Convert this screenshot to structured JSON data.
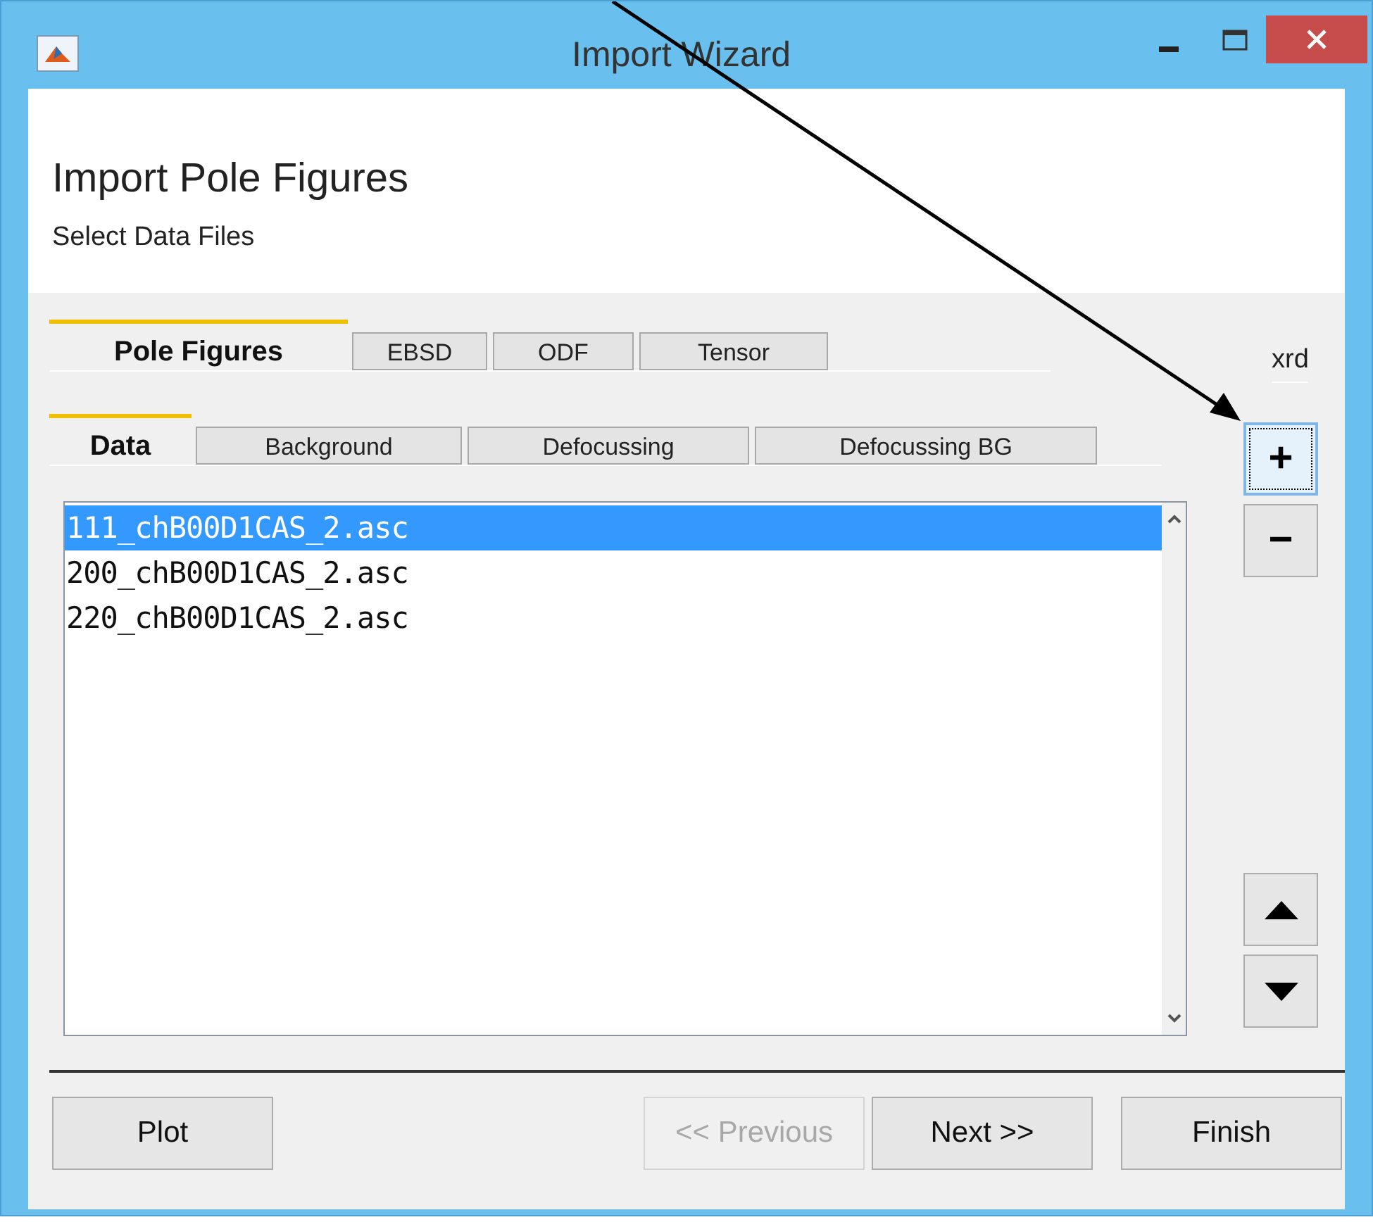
{
  "window": {
    "title": "Import Wizard"
  },
  "header": {
    "title": "Import Pole Figures",
    "subtitle": "Select Data Files"
  },
  "tabs": [
    {
      "label": "Pole Figures",
      "selected": true
    },
    {
      "label": "EBSD",
      "selected": false
    },
    {
      "label": "ODF",
      "selected": false
    },
    {
      "label": "Tensor",
      "selected": false
    }
  ],
  "format_label": "xrd",
  "subtabs": [
    {
      "label": "Data",
      "selected": true
    },
    {
      "label": "Background",
      "selected": false
    },
    {
      "label": "Defocussing",
      "selected": false
    },
    {
      "label": "Defocussing BG",
      "selected": false
    }
  ],
  "files": [
    {
      "name": "111_chB00D1CAS_2.asc",
      "selected": true
    },
    {
      "name": "200_chB00D1CAS_2.asc",
      "selected": false
    },
    {
      "name": "220_chB00D1CAS_2.asc",
      "selected": false
    }
  ],
  "side_buttons": [
    {
      "label": "+",
      "focused": true
    },
    {
      "label": "−",
      "focused": false
    }
  ],
  "buttons": [
    {
      "label": "Plot",
      "disabled": false
    },
    {
      "label": "<< Previous",
      "disabled": true
    },
    {
      "label": "Next >>",
      "disabled": false
    },
    {
      "label": "Finish",
      "disabled": false
    }
  ]
}
